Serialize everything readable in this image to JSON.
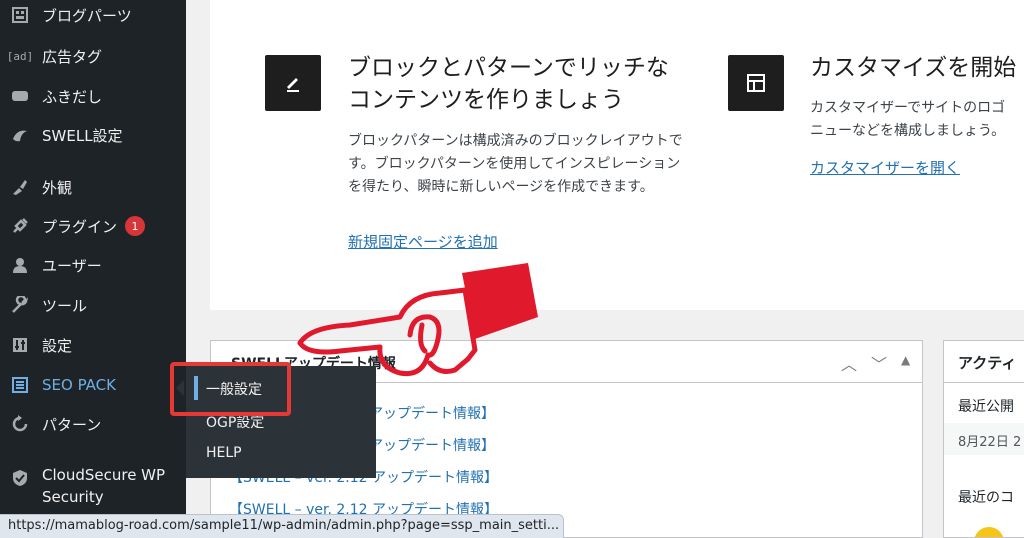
{
  "sidebar": {
    "items": [
      {
        "label": "ブログパーツ",
        "icon": "blog-parts-icon"
      },
      {
        "label": "広告タグ",
        "icon": "ad-tag-icon"
      },
      {
        "label": "ふきだし",
        "icon": "speech-bubble-icon"
      },
      {
        "label": "SWELL設定",
        "icon": "swell-icon"
      },
      {
        "label": "外観",
        "icon": "appearance-brush-icon"
      },
      {
        "label": "プラグイン",
        "icon": "plugin-icon",
        "badge": "1"
      },
      {
        "label": "ユーザー",
        "icon": "user-icon"
      },
      {
        "label": "ツール",
        "icon": "wrench-icon"
      },
      {
        "label": "設定",
        "icon": "settings-sliders-icon"
      },
      {
        "label": "SEO PACK",
        "icon": "list-icon"
      },
      {
        "label": "パターン",
        "icon": "pattern-refresh-icon"
      },
      {
        "label": "CloudSecure WP Security",
        "icon": "shield-check-icon"
      }
    ]
  },
  "flyout": {
    "items": [
      "一般設定",
      "OGP設定",
      "HELP"
    ]
  },
  "welcome": {
    "block_title_line1": "ブロックとパターンでリッチな",
    "block_title_line2": "コンテンツを作りましょう",
    "block_desc": "ブロックパターンは構成済みのブロックレイアウトです。ブロックパターンを使用してインスピレーションを得たり、瞬時に新しいページを作成できます。",
    "block_link": "新規固定ページを追加",
    "custom_title": "カスタマイズを開始",
    "custom_desc_line1": "カスタマイザーでサイトのロゴ",
    "custom_desc_line2": "ニューなどを構成しましょう。",
    "custom_link": "カスタマイザーを開く"
  },
  "swell_widget": {
    "title": "SWELLアップデート情報",
    "news": [
      "アップデート情報】",
      "アップデート情報】",
      "【SWELL – ver. 2.12 アップデート情報】",
      "【SWELL – ver. 2.12 アップデート情報】"
    ]
  },
  "activity_widget": {
    "title": "アクティ",
    "recent_published": "最近公開",
    "date": "8月22日 2",
    "recent_comments": "最近のコ"
  },
  "status_url": "https://mamablog-road.com/sample11/wp-admin/admin.php?page=ssp_main_setti...",
  "colors": {
    "sidebar_bg": "#1d2327",
    "accent": "#72aee6",
    "link": "#2271b1",
    "highlight": "#e53935",
    "stamp": "#e0192d"
  }
}
